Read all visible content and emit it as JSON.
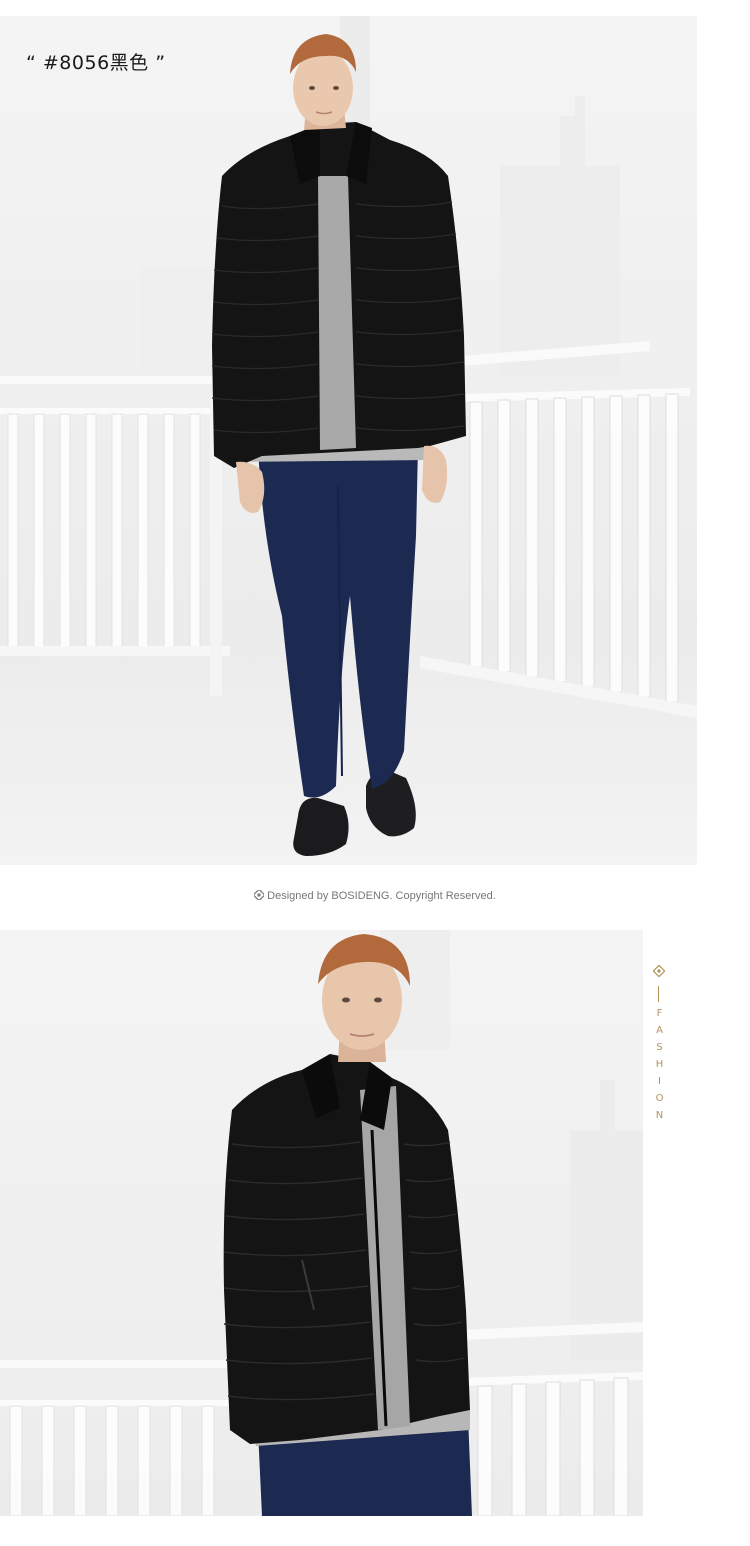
{
  "product_caption": "“ #8056黑色 ”",
  "footer": {
    "credit": "Designed by BOSIDENG. Copyright Reserved.",
    "logo_icon": "bosideng-logo-icon"
  },
  "side_label": {
    "word": "FASHION",
    "icon": "diamond-icon",
    "accent_color": "#b4935a"
  },
  "photos": [
    {
      "subject": "model-full-length",
      "jacket_color": "#141414",
      "trousers_color": "#1c2a52"
    },
    {
      "subject": "model-half-length",
      "jacket_color": "#141414",
      "trousers_color": "#1c2a52"
    }
  ]
}
